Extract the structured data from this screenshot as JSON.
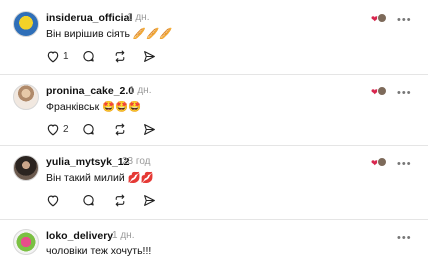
{
  "comments": [
    {
      "username": "insiderua_official",
      "time": "1 дн.",
      "text": "Він вирішив сіять 🥖🥖🥖",
      "likes": "1",
      "reactor_color": "#7d6a5a"
    },
    {
      "username": "pronina_cake_2.0",
      "time": "1 дн.",
      "text": "Франківськ 🤩🤩🤩",
      "likes": "2",
      "reactor_color": "#7d6a5a"
    },
    {
      "username": "yulia_mytsyk_12",
      "time": "23 год",
      "text": "Він такий милий 💋💋",
      "likes": "",
      "reactor_color": "#7d6a5a"
    },
    {
      "username": "loko_delivery",
      "time": "1 дн.",
      "text": "чоловіки теж хочуть!!!",
      "likes": "",
      "reactor_color": "#7d6a5a"
    }
  ],
  "icons": {
    "like": "heart-outline-icon",
    "reply": "speech-bubble-icon",
    "repost": "repost-arrows-icon",
    "share": "send-paper-plane-icon",
    "more": "more-dots-icon",
    "liked_by": "liked-heart-avatar-icon"
  },
  "colors": {
    "text": "#111111",
    "muted": "#9a9a9a",
    "divider": "#e5e5e5",
    "like_red": "#d8264e"
  }
}
